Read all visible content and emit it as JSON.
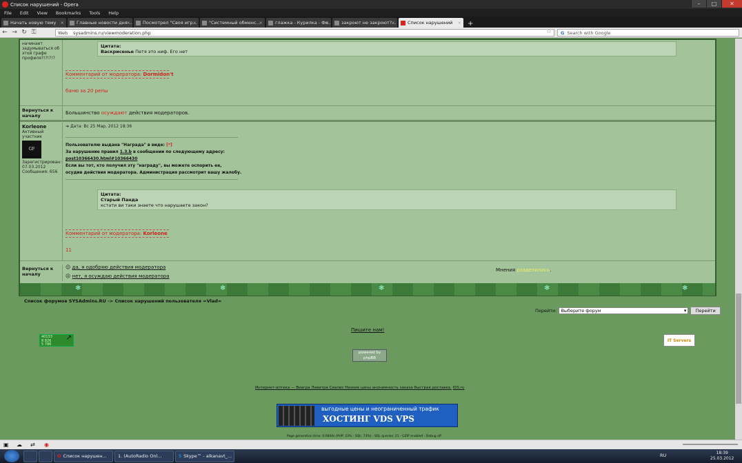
{
  "window": {
    "title": "Список нарушений - Opera"
  },
  "menu": [
    "File",
    "Edit",
    "View",
    "Bookmarks",
    "Tools",
    "Help"
  ],
  "tabs": [
    {
      "label": "Начать новую тему"
    },
    {
      "label": "Главные новости дня ..."
    },
    {
      "label": "Посмотрел \"Своя игр..."
    },
    {
      "label": "\"Системный обменс..."
    },
    {
      "label": "глажка - Курилка - Фо..."
    },
    {
      "label": "закроют не закроют?..."
    },
    {
      "label": "Список нарушений",
      "active": true
    }
  ],
  "nav": {
    "web_label": "Web",
    "url": "sysadmins.ru/viewmoderation.php",
    "search_placeholder": "Search with Google"
  },
  "post1": {
    "author_tail": "начинает задумываться об этой графе профиля?!?!?!?",
    "quote_title": "Цитата:",
    "quote_author": "Васкрисенье",
    "quote_text": "Петя это ниф. Его нет",
    "mod_comment_label": "Комментарий от модератора:",
    "mod_name": "Dormidon't",
    "ban_text": "баню за 20 репы"
  },
  "row_back1": {
    "label": "Вернуться к началу",
    "text_pre": "Большинство",
    "text_link": "осуждают",
    "text_post": "действия модераторов."
  },
  "post2": {
    "author": "Korleone",
    "rank": "Активный участник",
    "registered": "Зарегистрирован: 07.03.2012",
    "messages": "Сообщения: 656",
    "date": "Дата: Вс 25 Мар, 2012 18:36",
    "award_line": "Пользователю выдана \"Награда\" в виде:",
    "award_mark": "[*]",
    "violation_line": "За нарушение правил",
    "rule": "1.3.b",
    "violation_tail": "в сообщении по следующему адресу:",
    "post_link": "post10366430.html#10366430",
    "dispute_line1": "Если вы тот, кто получил эту \"награду\", вы можете оспорить ее,",
    "dispute_line2": "осудив действия модератора. Администрация рассмотрит вашу жалобу.",
    "quote_title": "Цитата:",
    "quote_author": "Старый Панда",
    "quote_text": "кстати ви таки знаете что нарушаете закон?",
    "mod_comment_label": "Комментарий от модератора:",
    "mod_name": "Korleone",
    "count": "11"
  },
  "row_back2": {
    "label": "Вернуться к началу",
    "approve": "да, я одобряю действия модератора",
    "condemn": "нет, я осуждаю действия модератора",
    "opinion_pre": "Мнения",
    "opinion_link": "разделились",
    "opinion_post": "."
  },
  "breadcrumb": "Список форумов SYSAdmins.RU -> Список нарушений пользователя =Vlad=",
  "jump": {
    "label": "Перейти:",
    "select": "Выберите форум",
    "button": "Перейти"
  },
  "footer": {
    "write_us": "Пишите нам!",
    "powered": "powered by phpBB",
    "links_text": "Интернет-аптека — Виагра Левитра Сиалис Низкие цены анонимность заказа быстрая доставка.",
    "ids": "IDS.ru",
    "counter_lines": [
      "40133",
      "8 826",
      "5 786"
    ],
    "it_servers": "IT Servers",
    "banner_top": "выгодные цены и неограниченный трафик",
    "banner_main": "ХОСТИНГ VDS VPS",
    "gen_time": "Page generation time: 0.0844s (PHP: 23% - SQL: 73%) - SQL queries: 21 - GZIP enabled - Debug off"
  },
  "taskbar": {
    "items": [
      "Список нарушен...",
      "1. (AutoRadio Onl...",
      "Skype™ - alkanavt_..."
    ],
    "lang": "RU",
    "time": "18:39",
    "date": "25.03.2012"
  }
}
